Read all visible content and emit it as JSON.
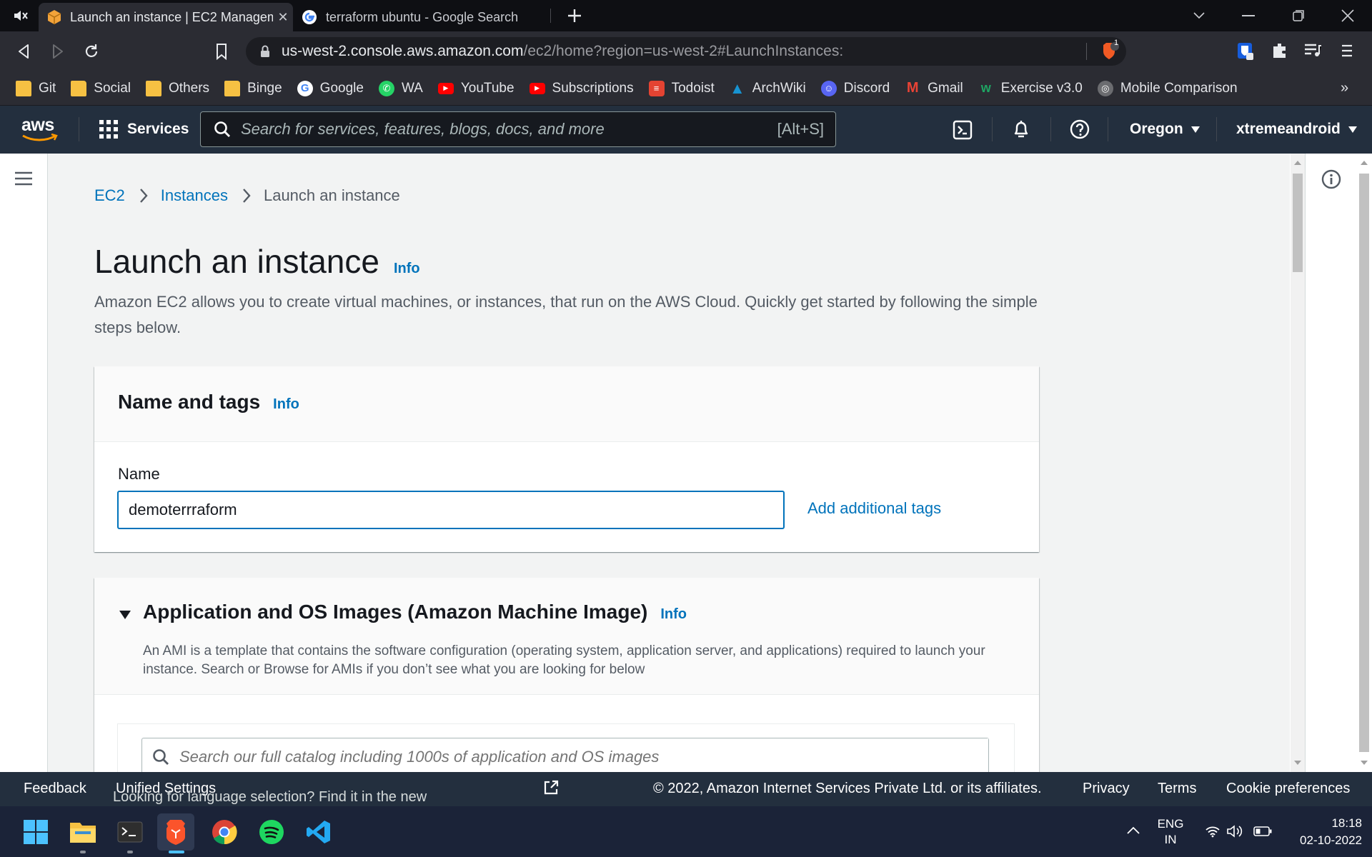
{
  "browser": {
    "tabs": [
      {
        "title": "Launch an instance | EC2 Management Console",
        "active": true
      },
      {
        "title": "terraform ubuntu - Google Search",
        "active": false
      }
    ],
    "url_host": "us-west-2.console.aws.amazon.com",
    "url_path": "/ec2/home?region=us-west-2#LaunchInstances:",
    "shield_count": "1",
    "bookmarks": [
      {
        "label": "Git",
        "icon": "folder-icon"
      },
      {
        "label": "Social",
        "icon": "folder-icon"
      },
      {
        "label": "Others",
        "icon": "folder-icon"
      },
      {
        "label": "Binge",
        "icon": "folder-icon"
      },
      {
        "label": "Google",
        "icon": "google-icon"
      },
      {
        "label": "WA",
        "icon": "whatsapp-icon"
      },
      {
        "label": "YouTube",
        "icon": "youtube-icon"
      },
      {
        "label": "Subscriptions",
        "icon": "youtube-icon"
      },
      {
        "label": "Todoist",
        "icon": "todoist-icon"
      },
      {
        "label": "ArchWiki",
        "icon": "arch-icon"
      },
      {
        "label": "Discord",
        "icon": "discord-icon"
      },
      {
        "label": "Gmail",
        "icon": "gmail-icon"
      },
      {
        "label": "Exercise v3.0",
        "icon": "exercise-icon"
      },
      {
        "label": "Mobile Comparison",
        "icon": "globe-icon"
      }
    ]
  },
  "aws_nav": {
    "logo": "aws",
    "services_label": "Services",
    "search_placeholder": "Search for services, features, blogs, docs, and more",
    "search_shortcut": "[Alt+S]",
    "region": "Oregon",
    "account": "xtremeandroid"
  },
  "breadcrumb": {
    "items": [
      "EC2",
      "Instances"
    ],
    "current": "Launch an instance"
  },
  "page": {
    "title": "Launch an instance",
    "info_label": "Info",
    "description": "Amazon EC2 allows you to create virtual machines, or instances, that run on the AWS Cloud. Quickly get started by following the simple steps below."
  },
  "name_tags": {
    "heading": "Name and tags",
    "info_label": "Info",
    "name_label": "Name",
    "name_value": "demoterrraform",
    "add_tags_label": "Add additional tags"
  },
  "ami": {
    "heading": "Application and OS Images (Amazon Machine Image)",
    "info_label": "Info",
    "description": "An AMI is a template that contains the software configuration (operating system, application server, and applications) required to launch your instance. Search or Browse for AMIs if you don’t see what you are looking for below",
    "search_placeholder": "Search our full catalog including 1000s of application and OS images"
  },
  "footer": {
    "feedback": "Feedback",
    "language_msg": "Looking for language selection? Find it in the new",
    "unified_settings": "Unified Settings",
    "copyright": "© 2022, Amazon Internet Services Private Ltd. or its affiliates.",
    "privacy": "Privacy",
    "terms": "Terms",
    "cookies": "Cookie preferences"
  },
  "taskbar": {
    "lang_line1": "ENG",
    "lang_line2": "IN",
    "time": "18:18",
    "date": "02-10-2022"
  },
  "colors": {
    "aws_nav": "#232f3e",
    "link": "#0073bb",
    "aws_orange": "#ff9900",
    "content_bg": "#f2f3f3"
  }
}
